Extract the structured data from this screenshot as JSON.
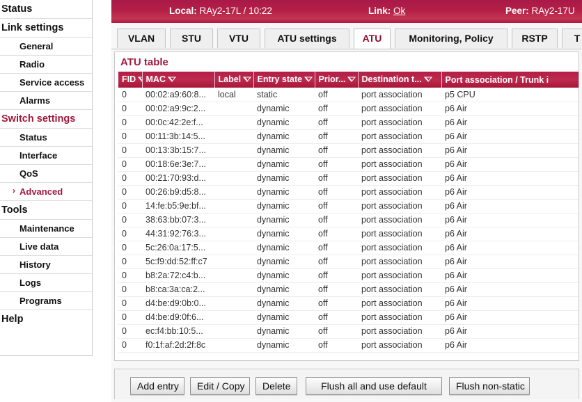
{
  "sidebar": {
    "items": [
      {
        "label": "Status",
        "type": "group",
        "active": false
      },
      {
        "label": "Link settings",
        "type": "group",
        "active": false
      },
      {
        "label": "General",
        "type": "item",
        "active": false
      },
      {
        "label": "Radio",
        "type": "item",
        "active": false
      },
      {
        "label": "Service access",
        "type": "item",
        "active": false
      },
      {
        "label": "Alarms",
        "type": "item",
        "active": false
      },
      {
        "label": "Switch settings",
        "type": "group-red",
        "active": false
      },
      {
        "label": "Status",
        "type": "item",
        "active": false
      },
      {
        "label": "Interface",
        "type": "item",
        "active": false
      },
      {
        "label": "QoS",
        "type": "item",
        "active": false
      },
      {
        "label": "Advanced",
        "type": "item",
        "active": true
      },
      {
        "label": "Tools",
        "type": "group",
        "active": false
      },
      {
        "label": "Maintenance",
        "type": "item",
        "active": false
      },
      {
        "label": "Live data",
        "type": "item",
        "active": false
      },
      {
        "label": "History",
        "type": "item",
        "active": false
      },
      {
        "label": "Logs",
        "type": "item",
        "active": false
      },
      {
        "label": "Programs",
        "type": "item",
        "active": false
      },
      {
        "label": "Help",
        "type": "group",
        "active": false
      }
    ]
  },
  "topbar": {
    "local_label": "Local:",
    "local_value": "RAy2-17L / 10:22",
    "link_label": "Link:",
    "link_value": "Ok",
    "peer_label": "Peer:",
    "peer_value": "RAy2-17U",
    "bg_color": "#b41f46"
  },
  "tabs": [
    {
      "label": "VLAN",
      "active": false
    },
    {
      "label": "STU",
      "active": false
    },
    {
      "label": "VTU",
      "active": false
    },
    {
      "label": "ATU settings",
      "active": false
    },
    {
      "label": "ATU",
      "active": true
    },
    {
      "label": "Monitoring, Policy",
      "active": false
    },
    {
      "label": "RSTP",
      "active": false
    },
    {
      "label": "T",
      "active": false
    }
  ],
  "panel": {
    "title": "ATU table",
    "accent_color": "#a2183d",
    "sort_icon": "sort-icon"
  },
  "table": {
    "columns": [
      {
        "label": "FID",
        "key": "fid"
      },
      {
        "label": "MAC",
        "key": "mac"
      },
      {
        "label": "Label",
        "key": "label"
      },
      {
        "label": "Entry state",
        "key": "state"
      },
      {
        "label": "Prior...",
        "key": "priority"
      },
      {
        "label": "Destination t...",
        "key": "dest"
      },
      {
        "label": "Port association / Trunk i",
        "key": "port"
      }
    ],
    "rows": [
      {
        "fid": "0",
        "mac": "00:02:a9:60:8...",
        "label": "local",
        "state": "static",
        "priority": "off",
        "dest": "port association",
        "port": "p5 CPU"
      },
      {
        "fid": "0",
        "mac": "00:02:a9:9c:2...",
        "label": "",
        "state": "dynamic",
        "priority": "off",
        "dest": "port association",
        "port": "p6 Air"
      },
      {
        "fid": "0",
        "mac": "00:0c:42:2e:f...",
        "label": "",
        "state": "dynamic",
        "priority": "off",
        "dest": "port association",
        "port": "p6 Air"
      },
      {
        "fid": "0",
        "mac": "00:11:3b:14:5...",
        "label": "",
        "state": "dynamic",
        "priority": "off",
        "dest": "port association",
        "port": "p6 Air"
      },
      {
        "fid": "0",
        "mac": "00:13:3b:15:7...",
        "label": "",
        "state": "dynamic",
        "priority": "off",
        "dest": "port association",
        "port": "p6 Air"
      },
      {
        "fid": "0",
        "mac": "00:18:6e:3e:7...",
        "label": "",
        "state": "dynamic",
        "priority": "off",
        "dest": "port association",
        "port": "p6 Air"
      },
      {
        "fid": "0",
        "mac": "00:21:70:93:d...",
        "label": "",
        "state": "dynamic",
        "priority": "off",
        "dest": "port association",
        "port": "p6 Air"
      },
      {
        "fid": "0",
        "mac": "00:26:b9:d5:8...",
        "label": "",
        "state": "dynamic",
        "priority": "off",
        "dest": "port association",
        "port": "p6 Air"
      },
      {
        "fid": "0",
        "mac": "14:fe:b5:9e:bf...",
        "label": "",
        "state": "dynamic",
        "priority": "off",
        "dest": "port association",
        "port": "p6 Air"
      },
      {
        "fid": "0",
        "mac": "38:63:bb:07:3...",
        "label": "",
        "state": "dynamic",
        "priority": "off",
        "dest": "port association",
        "port": "p6 Air"
      },
      {
        "fid": "0",
        "mac": "44:31:92:76:3...",
        "label": "",
        "state": "dynamic",
        "priority": "off",
        "dest": "port association",
        "port": "p6 Air"
      },
      {
        "fid": "0",
        "mac": "5c:26:0a:17:5...",
        "label": "",
        "state": "dynamic",
        "priority": "off",
        "dest": "port association",
        "port": "p6 Air"
      },
      {
        "fid": "0",
        "mac": "5c:f9:dd:52:ff:c7",
        "label": "",
        "state": "dynamic",
        "priority": "off",
        "dest": "port association",
        "port": "p6 Air"
      },
      {
        "fid": "0",
        "mac": "b8:2a:72:c4:b...",
        "label": "",
        "state": "dynamic",
        "priority": "off",
        "dest": "port association",
        "port": "p6 Air"
      },
      {
        "fid": "0",
        "mac": "b8:ca:3a:ca:2...",
        "label": "",
        "state": "dynamic",
        "priority": "off",
        "dest": "port association",
        "port": "p6 Air"
      },
      {
        "fid": "0",
        "mac": "d4:be:d9:0b:0...",
        "label": "",
        "state": "dynamic",
        "priority": "off",
        "dest": "port association",
        "port": "p6 Air"
      },
      {
        "fid": "0",
        "mac": "d4:be:d9:0f:6...",
        "label": "",
        "state": "dynamic",
        "priority": "off",
        "dest": "port association",
        "port": "p6 Air"
      },
      {
        "fid": "0",
        "mac": "ec:f4:bb:10:5...",
        "label": "",
        "state": "dynamic",
        "priority": "off",
        "dest": "port association",
        "port": "p6 Air"
      },
      {
        "fid": "0",
        "mac": "f0:1f:af:2d:2f:8c",
        "label": "",
        "state": "dynamic",
        "priority": "off",
        "dest": "port association",
        "port": "p6 Air"
      }
    ]
  },
  "buttons": [
    {
      "label": "Add entry"
    },
    {
      "label": "Edit / Copy"
    },
    {
      "label": "Delete"
    },
    {
      "label": "Flush all and use default"
    },
    {
      "label": "Flush non-static"
    }
  ]
}
